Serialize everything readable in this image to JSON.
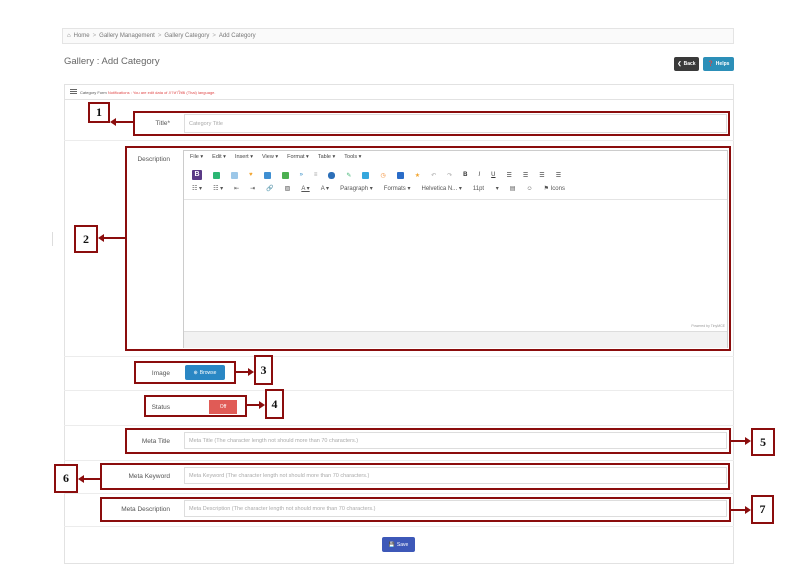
{
  "breadcrumb": {
    "home": "Home",
    "items": [
      "Gallery Management",
      "Gallery Category",
      "Add Category"
    ],
    "separator": ">"
  },
  "page": {
    "title": "Gallery : Add Category"
  },
  "header_buttons": {
    "back": "Back",
    "help": "Helps"
  },
  "form_header": {
    "title": "Category Form",
    "notification": "Notifications : You are edit data of ภาษาไทย (Thai) language."
  },
  "fields": {
    "title": {
      "label": "Title*",
      "placeholder": "Category Title"
    },
    "description": {
      "label": "Description"
    },
    "image": {
      "label": "Image",
      "button": "Browse"
    },
    "status": {
      "label": "Status",
      "value": "Off"
    },
    "meta_title": {
      "label": "Meta Title",
      "placeholder": "Meta Title (The character length not should more than 70 characters.)"
    },
    "meta_keyword": {
      "label": "Meta Keyword",
      "placeholder": "Meta Keyword (The character length not should more than 70 characters.)"
    },
    "meta_description": {
      "label": "Meta Description",
      "placeholder": "Meta Description (The character length not should more than 70 characters.)"
    }
  },
  "editor": {
    "menus": [
      "File ▾",
      "Edit ▾",
      "Insert ▾",
      "View ▾",
      "Format ▾",
      "Table ▾",
      "Tools ▾"
    ],
    "toolbar2": {
      "paragraph": "Paragraph",
      "formats": "Formats",
      "font": "Helvetica N...",
      "size": "11pt",
      "icons": "Icons"
    },
    "powered_by": "Powered by TinyMCE"
  },
  "save_button": "Save",
  "annotations": [
    "1",
    "2",
    "3",
    "4",
    "5",
    "6",
    "7"
  ],
  "colors": {
    "annotation": "#8b0d0d",
    "browse": "#2a87c4",
    "toggle_off": "#e05b56",
    "save": "#3d58b8",
    "help": "#2c8fb8"
  }
}
